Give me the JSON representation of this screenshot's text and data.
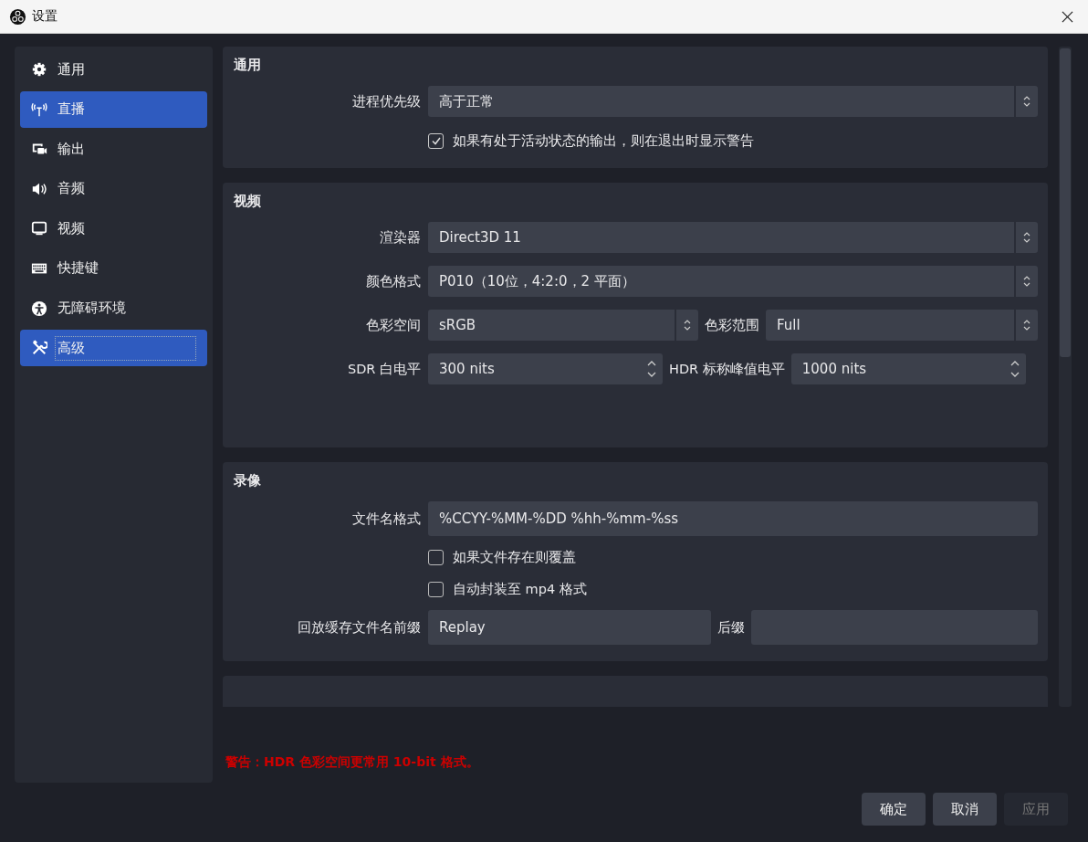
{
  "window": {
    "title": "设置"
  },
  "sidebar": {
    "items": [
      {
        "label": "通用",
        "selected": false,
        "focused": false
      },
      {
        "label": "直播",
        "selected": true,
        "focused": false
      },
      {
        "label": "输出",
        "selected": false,
        "focused": false
      },
      {
        "label": "音频",
        "selected": false,
        "focused": false
      },
      {
        "label": "视频",
        "selected": false,
        "focused": false
      },
      {
        "label": "快捷键",
        "selected": false,
        "focused": false
      },
      {
        "label": "无障碍环境",
        "selected": false,
        "focused": false
      },
      {
        "label": "高级",
        "selected": true,
        "focused": true
      }
    ]
  },
  "sections": [
    {
      "title": "通用",
      "rows": [
        {
          "kind": "select",
          "label": "进程优先级",
          "value": "高于正常"
        },
        {
          "kind": "checkbox",
          "label": "如果有处于活动状态的输出，则在退出时显示警告",
          "checked": true
        }
      ]
    },
    {
      "title": "视频",
      "rows": [
        {
          "kind": "select",
          "label": "渲染器",
          "value": "Direct3D 11"
        },
        {
          "kind": "select",
          "label": "颜色格式",
          "value": "P010（10位，4:2:0，2 平面）"
        },
        {
          "kind": "select-pair",
          "label": "色彩空间",
          "value": "sRGB",
          "label_2": "色彩范围",
          "value_2": "Full"
        },
        {
          "kind": "spin-pair",
          "label": "SDR 白电平",
          "value": "300 nits",
          "label_2": "HDR 标称峰值电平",
          "value_2": "1000 nits"
        }
      ]
    },
    {
      "title": "录像",
      "rows": [
        {
          "kind": "text",
          "label": "文件名格式",
          "value": "%CCYY-%MM-%DD %hh-%mm-%ss"
        },
        {
          "kind": "checkbox",
          "label": "如果文件存在则覆盖",
          "checked": false
        },
        {
          "kind": "checkbox",
          "label": "自动封装至 mp4 格式",
          "checked": false
        },
        {
          "kind": "text-pair",
          "label": "回放缓存文件名前缀",
          "value": "Replay",
          "label_2": "后缀"
        }
      ]
    }
  ],
  "warning": "警告：HDR 色彩空间更常用 10-bit 格式。",
  "buttons": [
    {
      "label": "确定",
      "disabled": false
    },
    {
      "label": "取消",
      "disabled": false
    },
    {
      "label": "应用",
      "disabled": true
    }
  ]
}
